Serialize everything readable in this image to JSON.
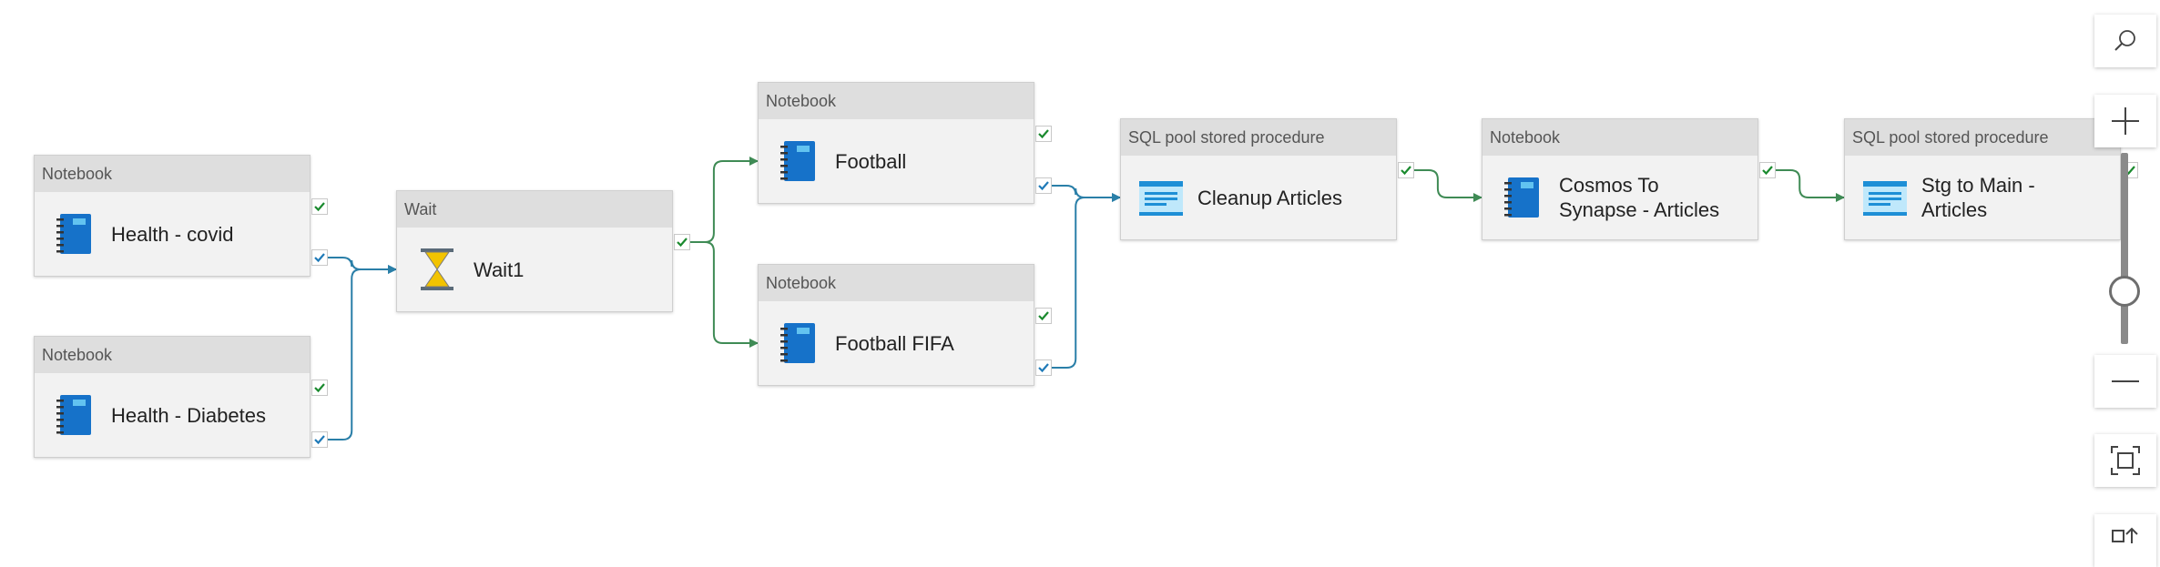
{
  "nodes": [
    {
      "id": "n1",
      "type": "Notebook",
      "label": "Health - covid",
      "icon": "notebook-icon"
    },
    {
      "id": "n2",
      "type": "Notebook",
      "label": "Health - Diabetes",
      "icon": "notebook-icon"
    },
    {
      "id": "n3",
      "type": "Wait",
      "label": "Wait1",
      "icon": "hourglass-icon"
    },
    {
      "id": "n4",
      "type": "Notebook",
      "label": "Football",
      "icon": "notebook-icon"
    },
    {
      "id": "n5",
      "type": "Notebook",
      "label": "Football FIFA",
      "icon": "notebook-icon"
    },
    {
      "id": "n6",
      "type": "SQL pool stored procedure",
      "label": "Cleanup Articles",
      "icon": "stored-procedure-icon"
    },
    {
      "id": "n7",
      "type": "Notebook",
      "label": "Cosmos To Synapse - Articles",
      "icon": "notebook-icon"
    },
    {
      "id": "n8",
      "type": "SQL pool stored procedure",
      "label": "Stg to Main - Articles",
      "icon": "stored-procedure-icon"
    }
  ],
  "edges": [
    {
      "from": "n1",
      "to": "n3",
      "port": "completion"
    },
    {
      "from": "n2",
      "to": "n3",
      "port": "completion"
    },
    {
      "from": "n3",
      "to": "n4",
      "port": "success"
    },
    {
      "from": "n3",
      "to": "n5",
      "port": "success"
    },
    {
      "from": "n4",
      "to": "n6",
      "port": "completion"
    },
    {
      "from": "n5",
      "to": "n6",
      "port": "completion"
    },
    {
      "from": "n6",
      "to": "n7",
      "port": "success"
    },
    {
      "from": "n7",
      "to": "n8",
      "port": "success"
    }
  ],
  "colors": {
    "success_edge": "#3f8b55",
    "completion_edge": "#2a7fa8",
    "success_check": "#1a8a2e",
    "completion_check": "#1f7ab8",
    "notebook_icon": "#1672c9",
    "hourglass": "#f2c300"
  },
  "zoom_controls": [
    {
      "name": "search",
      "icon": "search-icon"
    },
    {
      "name": "zoom-in",
      "icon": "plus-icon"
    },
    {
      "name": "zoom-slider",
      "icon": "slider"
    },
    {
      "name": "zoom-out",
      "icon": "minus-icon"
    },
    {
      "name": "fit-to-window",
      "icon": "fit-icon"
    },
    {
      "name": "auto-align",
      "icon": "auto-align-icon"
    }
  ]
}
